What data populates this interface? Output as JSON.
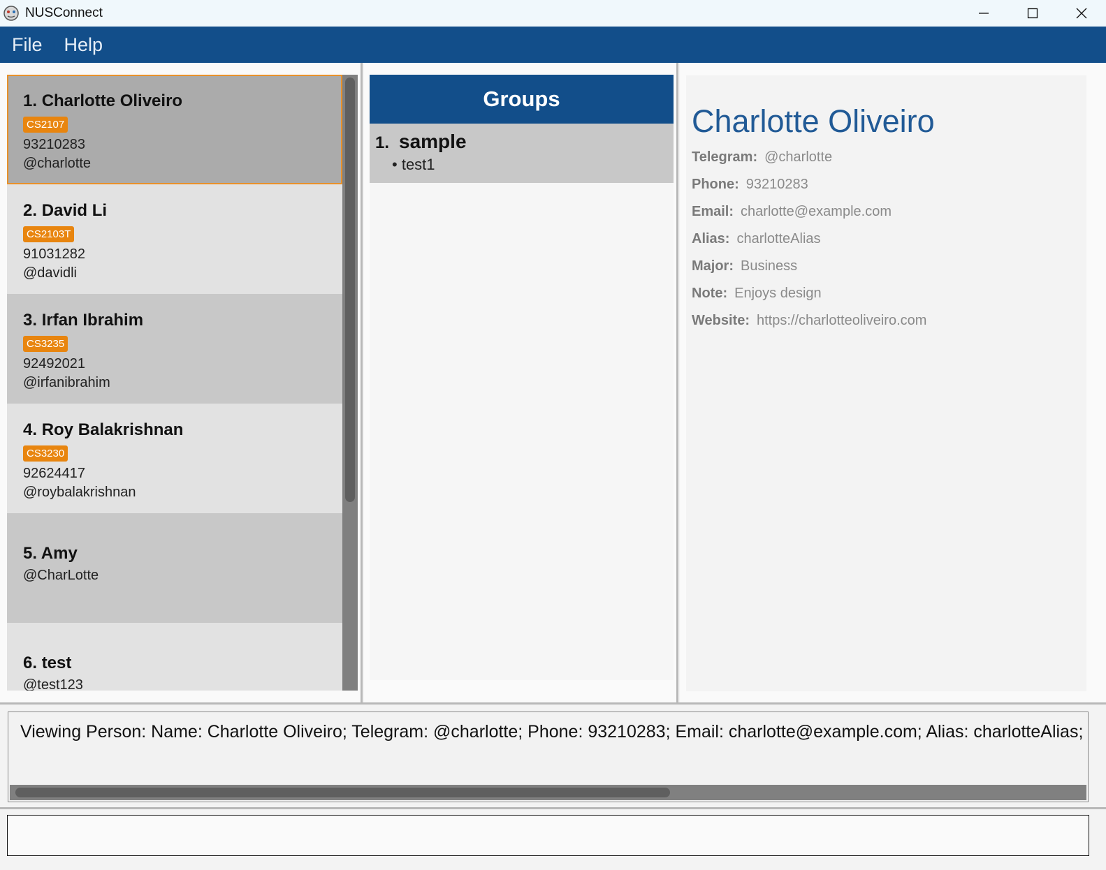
{
  "window": {
    "title": "NUSConnect"
  },
  "menu": {
    "file": "File",
    "help": "Help"
  },
  "persons": [
    {
      "index": "1.",
      "name": "Charlotte Oliveiro",
      "tag": "CS2107",
      "phone": "93210283",
      "telegram": "@charlotte",
      "bg": "#ababab",
      "selected": true
    },
    {
      "index": "2.",
      "name": "David Li",
      "tag": "CS2103T",
      "phone": "91031282",
      "telegram": "@davidli",
      "bg": "#e2e2e2"
    },
    {
      "index": "3.",
      "name": "Irfan Ibrahim",
      "tag": "CS3235",
      "phone": "92492021",
      "telegram": "@irfanibrahim",
      "bg": "#c8c8c8"
    },
    {
      "index": "4.",
      "name": "Roy Balakrishnan",
      "tag": "CS3230",
      "phone": "92624417",
      "telegram": "@roybalakrishnan",
      "bg": "#e2e2e2"
    },
    {
      "index": "5.",
      "name": "Amy",
      "telegram": "@CharLotte",
      "bg": "#c8c8c8"
    },
    {
      "index": "6.",
      "name": "test",
      "telegram": "@test123",
      "bg": "#e2e2e2"
    }
  ],
  "groups": {
    "header": "Groups",
    "items": [
      {
        "index": "1.",
        "name": "sample",
        "members": [
          "test1"
        ]
      }
    ]
  },
  "details": {
    "name": "Charlotte Oliveiro",
    "fields": [
      {
        "label": "Telegram:",
        "value": "@charlotte"
      },
      {
        "label": "Phone:",
        "value": "93210283"
      },
      {
        "label": "Email:",
        "value": "charlotte@example.com"
      },
      {
        "label": "Alias:",
        "value": "charlotteAlias"
      },
      {
        "label": "Major:",
        "value": "Business"
      },
      {
        "label": "Note:",
        "value": "Enjoys design"
      },
      {
        "label": "Website:",
        "value": "https://charlotteoliveiro.com"
      }
    ]
  },
  "result": {
    "text": "Viewing Person: Name: Charlotte Oliveiro; Telegram: @charlotte; Phone: 93210283; Email: charlotte@example.com; Alias: charlotteAlias; Major"
  },
  "command": {
    "value": ""
  },
  "colors": {
    "accent": "#124e8a",
    "tag": "#e8850f",
    "selection_border": "#e8912a",
    "detail_name": "#215a96"
  }
}
